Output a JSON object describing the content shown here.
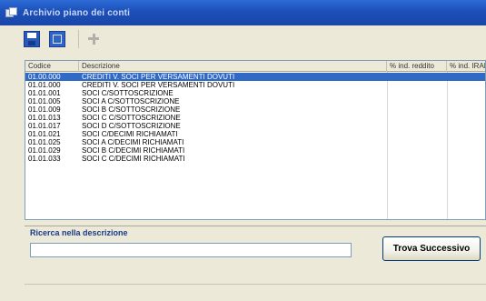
{
  "window": {
    "title": "Archivio piano dei conti"
  },
  "toolbar": {
    "buttons": [
      "save-icon",
      "grid-icon",
      "tools-icon"
    ]
  },
  "list": {
    "columns": [
      "Codice",
      "Descrizione",
      "% ind. reddito",
      "% ind. IRAP"
    ],
    "rows": [
      {
        "code": "01.00.000",
        "desc": "CREDITI V. SOCI PER VERSAMENTI DOVUTI",
        "selected": true
      },
      {
        "code": "01.01.000",
        "desc": "CREDITI V. SOCI PER VERSAMENTI DOVUTI",
        "selected": false
      },
      {
        "code": "01.01.001",
        "desc": "SOCI C/SOTTOSCRIZIONE",
        "selected": false
      },
      {
        "code": "01.01.005",
        "desc": "SOCI A C/SOTTOSCRIZIONE",
        "selected": false
      },
      {
        "code": "01.01.009",
        "desc": "SOCI B C/SOTTOSCRIZIONE",
        "selected": false
      },
      {
        "code": "01.01.013",
        "desc": "SOCI C C/SOTTOSCRIZIONE",
        "selected": false
      },
      {
        "code": "01.01.017",
        "desc": "SOCI D C/SOTTOSCRIZIONE",
        "selected": false
      },
      {
        "code": "01.01.021",
        "desc": "SOCI C/DECIMI RICHIAMATI",
        "selected": false
      },
      {
        "code": "01.01.025",
        "desc": "SOCI A C/DECIMI RICHIAMATI",
        "selected": false
      },
      {
        "code": "01.01.029",
        "desc": "SOCI B C/DECIMI RICHIAMATI",
        "selected": false
      },
      {
        "code": "01.01.033",
        "desc": "SOCI C C/DECIMI RICHIAMATI",
        "selected": false
      }
    ]
  },
  "search": {
    "label": "Ricerca nella descrizione",
    "value": "",
    "button_label": "Trova Successivo"
  },
  "colors": {
    "titlebar": "#1c4fb8",
    "selection": "#316ac5",
    "search_label": "#1a3a8a"
  }
}
